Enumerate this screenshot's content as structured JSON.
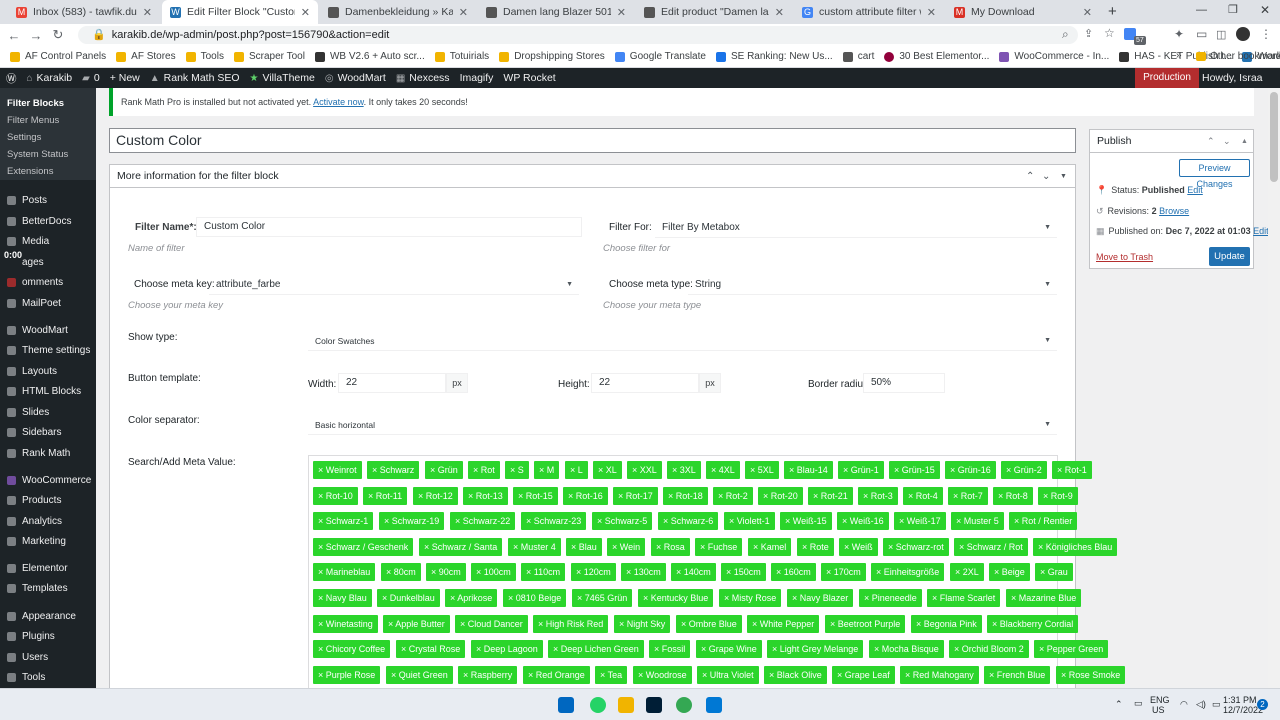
{
  "browser": {
    "tabs": [
      {
        "title": "Inbox (583) - tawfik.dukhan@gr"
      },
      {
        "title": "Edit Filter Block \"Custom Color\""
      },
      {
        "title": "Damenbekleidung » Karakib"
      },
      {
        "title": "Damen lang Blazer 501 » Karaki"
      },
      {
        "title": "Edit product \"Damen lang Blaze"
      },
      {
        "title": "custom attribute filter woocom"
      },
      {
        "title": "My Download"
      }
    ],
    "url": "karakib.de/wp-admin/post.php?post=156790&action=edit",
    "bookmarks": [
      "AF Control Panels",
      "AF Stores",
      "Tools",
      "Scraper Tool",
      "WB V2.6 + Auto scr...",
      "Totuirials",
      "Dropshipping Stores",
      "Google Translate",
      "SE Ranking: New Us...",
      "cart",
      "30 Best Elementor...",
      "WooCommerce - In...",
      "HAS - KET Publish t...",
      "WordPress to App..."
    ],
    "other_bookmarks": "Other bookmarks",
    "extension_badge": "57"
  },
  "adminbar": {
    "items": [
      "Karakib",
      "0",
      "+ New",
      "Rank Math SEO",
      "VillaTheme",
      "WoodMart",
      "Nexcess",
      "Imagify",
      "WP Rocket"
    ],
    "environment": "Production",
    "howdy": "Howdy, Israa"
  },
  "sidebar": {
    "submenu": [
      "Filter Blocks",
      "Filter Menus",
      "Settings",
      "System Status",
      "Extensions"
    ],
    "timer": "0:00",
    "menu": [
      "Posts",
      "BetterDocs",
      "Media",
      "ages",
      "omments",
      "MailPoet",
      "WoodMart",
      "Theme settings",
      "Layouts",
      "HTML Blocks",
      "Slides",
      "Sidebars",
      "Rank Math",
      "WooCommerce",
      "Products",
      "Analytics",
      "Marketing",
      "Elementor",
      "Templates",
      "Appearance",
      "Plugins",
      "Users",
      "Tools"
    ]
  },
  "notice": {
    "text": "Rank Math Pro is installed but not activated yet.",
    "link": "Activate now",
    "suffix": ". It only takes 20 seconds!"
  },
  "post_title": "Custom Color",
  "metabox": {
    "title": "More information for the filter block",
    "filter_name_label": "Filter Name*:",
    "filter_name_value": "Custom Color",
    "filter_name_hint": "Name of filter",
    "filter_for_label": "Filter For:",
    "filter_for_value": "Filter By Metabox",
    "filter_for_hint": "Choose filter for",
    "meta_key_label": "Choose meta key:",
    "meta_key_value": "attribute_farbe",
    "meta_key_hint": "Choose your meta key",
    "meta_type_label": "Choose meta type:",
    "meta_type_value": "String",
    "meta_type_hint": "Choose your meta type",
    "show_type_label": "Show type:",
    "show_type_value": "Color Swatches",
    "button_template_label": "Button template:",
    "width_label": "Width:",
    "width_value": "22",
    "height_label": "Height:",
    "height_value": "22",
    "unit": "px",
    "border_radius_label": "Border radius:",
    "border_radius_value": "50%",
    "separator_label": "Color separator:",
    "separator_value": "Basic horizontal",
    "meta_value_label": "Search/Add Meta Value:",
    "tags": [
      [
        "Weinrot",
        "Schwarz",
        "Grün",
        "Rot",
        "S",
        "M",
        "L",
        "XL",
        "XXL",
        "3XL",
        "4XL",
        "5XL",
        "Blau-14",
        "Grün-1",
        "Grün-15",
        "Grün-16",
        "Grün-2",
        "Rot-1"
      ],
      [
        "Rot-10",
        "Rot-11",
        "Rot-12",
        "Rot-13",
        "Rot-15",
        "Rot-16",
        "Rot-17",
        "Rot-18",
        "Rot-2",
        "Rot-20",
        "Rot-21",
        "Rot-3",
        "Rot-4",
        "Rot-7",
        "Rot-8",
        "Rot-9"
      ],
      [
        "Schwarz-1",
        "Schwarz-19",
        "Schwarz-22",
        "Schwarz-23",
        "Schwarz-5",
        "Schwarz-6",
        "Violett-1",
        "Weiß-15",
        "Weiß-16",
        "Weiß-17",
        "Muster 5",
        "Rot / Rentier"
      ],
      [
        "Schwarz / Geschenk",
        "Schwarz / Santa",
        "Muster 4",
        "Blau",
        "Wein",
        "Rosa",
        "Fuchse",
        "Kamel",
        "Rote",
        "Weiß",
        "Schwarz-rot",
        "Schwarz / Rot",
        "Königliches Blau"
      ],
      [
        "Marineblau",
        "80cm",
        "90cm",
        "100cm",
        "110cm",
        "120cm",
        "130cm",
        "140cm",
        "150cm",
        "160cm",
        "170cm",
        "Einheitsgröße",
        "2XL",
        "Beige",
        "Grau"
      ],
      [
        "Navy Blau",
        "Dunkelblau",
        "Aprikose",
        "0810 Beige",
        "7465 Grün",
        "Kentucky Blue",
        "Misty Rose",
        "Navy Blazer",
        "Pineneedle",
        "Flame Scarlet",
        "Mazarine Blue"
      ],
      [
        "Winetasting",
        "Apple Butter",
        "Cloud Dancer",
        "High Risk Red",
        "Night Sky",
        "Ombre Blue",
        "White Pepper",
        "Beetroot Purple",
        "Begonia Pink",
        "Blackberry Cordial"
      ],
      [
        "Chicory Coffee",
        "Crystal Rose",
        "Deep Lagoon",
        "Deep Lichen Green",
        "Fossil",
        "Grape Wine",
        "Light Grey Melange",
        "Mocha Bisque",
        "Orchid Bloom 2",
        "Pepper Green"
      ],
      [
        "Purple Rose",
        "Quiet Green",
        "Raspberry",
        "Red Orange",
        "Tea",
        "Woodrose",
        "Ultra Violet",
        "Black Olive",
        "Grape Leaf",
        "Red Mahogany",
        "French Blue",
        "Rose Smoke"
      ]
    ]
  },
  "publish": {
    "title": "Publish",
    "preview": "Preview Changes",
    "status_label": "Status:",
    "status_value": "Published",
    "revisions_label": "Revisions:",
    "revisions_value": "2",
    "published_label": "Published on:",
    "published_value": "Dec 7, 2022 at 01:03",
    "edit": "Edit",
    "browse": "Browse",
    "trash": "Move to Trash",
    "update": "Update"
  },
  "taskbar": {
    "lang": "ENG",
    "region": "US",
    "time": "1:31 PM",
    "date": "12/7/2022",
    "notif": "2"
  },
  "colors": {
    "tag_bg": "#2bd52b",
    "admin_bg": "#1d2327",
    "accent": "#2271b1",
    "production": "#b32d2e"
  }
}
